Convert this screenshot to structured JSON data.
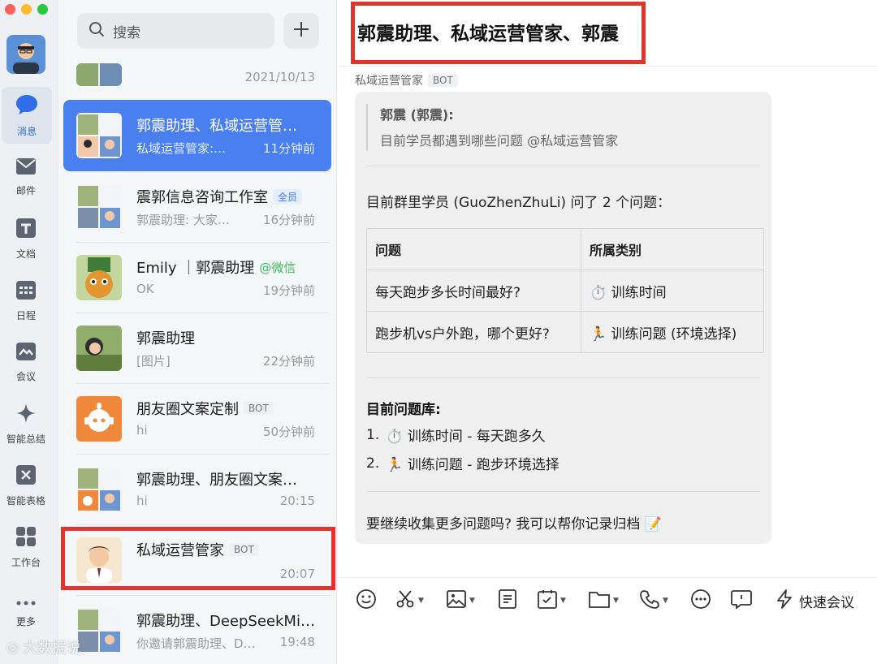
{
  "nav": {
    "items": [
      {
        "label": "消息",
        "icon": "chat-bubble-icon"
      },
      {
        "label": "邮件",
        "icon": "mail-icon"
      },
      {
        "label": "文档",
        "icon": "document-icon"
      },
      {
        "label": "日程",
        "icon": "calendar-icon"
      },
      {
        "label": "会议",
        "icon": "meeting-icon"
      },
      {
        "label": "智能总结",
        "icon": "sparkle-icon"
      },
      {
        "label": "智能表格",
        "icon": "smart-sheet-icon"
      },
      {
        "label": "工作台",
        "icon": "grid-icon"
      },
      {
        "label": "更多",
        "icon": "more-dots-icon"
      }
    ]
  },
  "search": {
    "placeholder": "搜索"
  },
  "conversations": [
    {
      "name": "",
      "preview": "",
      "time": "2021/10/13"
    },
    {
      "name": "郭震助理、私域运营管…",
      "preview": "私域运营管家:…",
      "time": "11分钟前"
    },
    {
      "name": "震郭信息咨询工作室",
      "tag": "全员",
      "preview": "郭震助理: 大家…",
      "time": "16分钟前"
    },
    {
      "name": "Emily ｜郭震助理",
      "tag": "@微信",
      "preview": "OK",
      "time": "19分钟前"
    },
    {
      "name": "郭震助理",
      "preview": "[图片]",
      "time": "22分钟前"
    },
    {
      "name": "朋友圈文案定制",
      "tag": "BOT",
      "preview": "hi",
      "time": "50分钟前"
    },
    {
      "name": "郭震助理、朋友圈文案…",
      "preview": "hi",
      "time": "20:15"
    },
    {
      "name": "私域运营管家",
      "tag": "BOT",
      "preview": "",
      "time": "20:07"
    },
    {
      "name": "郭震助理、DeepSeekMi…",
      "preview": "你邀请郭震助理、D…",
      "time": "19:48"
    }
  ],
  "chat": {
    "title": "郭震助理、私域运营管家、郭震",
    "sender": "私域运营管家",
    "sender_tag": "BOT",
    "quote_name": "郭震 (郭震):",
    "quote_text": "目前学员都遇到哪些问题 @私域运营管家",
    "intro": "目前群里学员 (GuoZhenZhuLi) 问了 2 个问题：",
    "table": {
      "headers": [
        "问题",
        "所属类别"
      ],
      "rows": [
        [
          "每天跑步多长时间最好?",
          "⏱️ 训练时间"
        ],
        [
          "跑步机vs户外跑，哪个更好?",
          "🏃 训练问题 (环境选择)"
        ]
      ]
    },
    "library_title": "目前问题库:",
    "library": [
      {
        "num": "1.",
        "text": "⏱️ 训练时间 - 每天跑多久"
      },
      {
        "num": "2.",
        "text": "🏃 训练问题 - 跑步环境选择"
      }
    ],
    "follow_up": "要继续收集更多问题吗? 我可以帮你记录归档 📝"
  },
  "toolbar": {
    "icons": [
      "emoji-icon",
      "scissors-icon",
      "image-icon",
      "note-icon",
      "calendar-check-icon",
      "folder-icon",
      "phone-icon",
      "more-icon",
      "bubble-icon"
    ],
    "quick_meeting": "快速会议"
  },
  "watermark": "大数据说",
  "colors": {
    "accent": "#4a7ff0",
    "highlight": "#e2342b"
  }
}
